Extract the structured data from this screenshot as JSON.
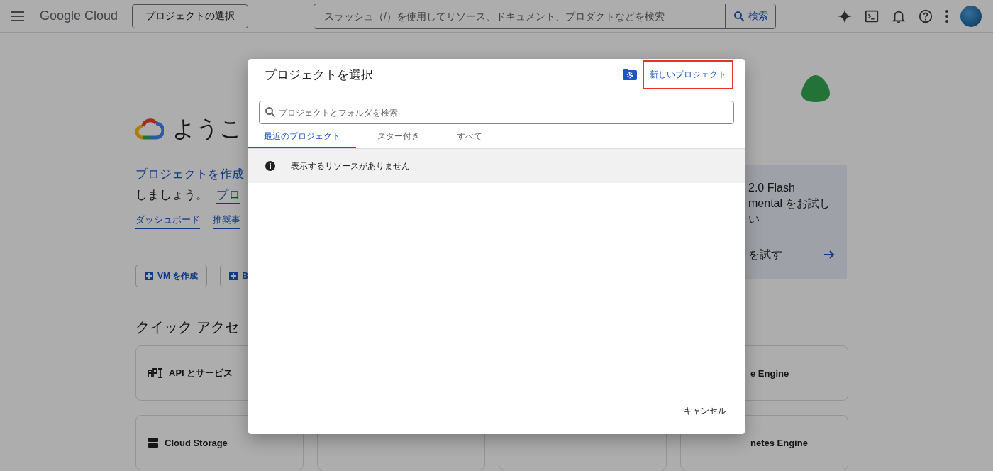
{
  "header": {
    "logo": "Google Cloud",
    "project_button": "プロジェクトの選択",
    "search": {
      "placeholder": "スラッシュ（/）を使用してリソース、ドキュメント、プロダクトなどを検索"
    },
    "search_button": "検索"
  },
  "page": {
    "heading": "ようこ",
    "intro_link": "プロジェクトを作成",
    "intro_text": "しましょう。",
    "intro_link_2": "プロ",
    "links": [
      "ダッシュボード",
      "推奨事"
    ],
    "actions": [
      "VM を作成",
      "B"
    ],
    "quick_access_title": "クイック アクセ",
    "quick_access": [
      {
        "label": "API とサービス"
      },
      {
        "label": "e Engine"
      },
      {
        "label": "Cloud Storage"
      },
      {
        "label": "netes Engine"
      }
    ],
    "promo": {
      "lines": [
        "2.0 Flash",
        "mental をお試し",
        "い"
      ],
      "link": "を試す"
    }
  },
  "dialog": {
    "title": "プロジェクトを選択",
    "new_project": {
      "label": "新しいプロジェクト",
      "highlighted": true
    },
    "search": {
      "placeholder": "プロジェクトとフォルダを検索"
    },
    "tabs": [
      {
        "label": "最近のプロジェクト",
        "selected": true
      },
      {
        "label": "スター付き",
        "selected": false
      },
      {
        "label": "すべて",
        "selected": false
      }
    ],
    "notice": "表示するリソースがありません",
    "cancel": "キャンセル"
  }
}
